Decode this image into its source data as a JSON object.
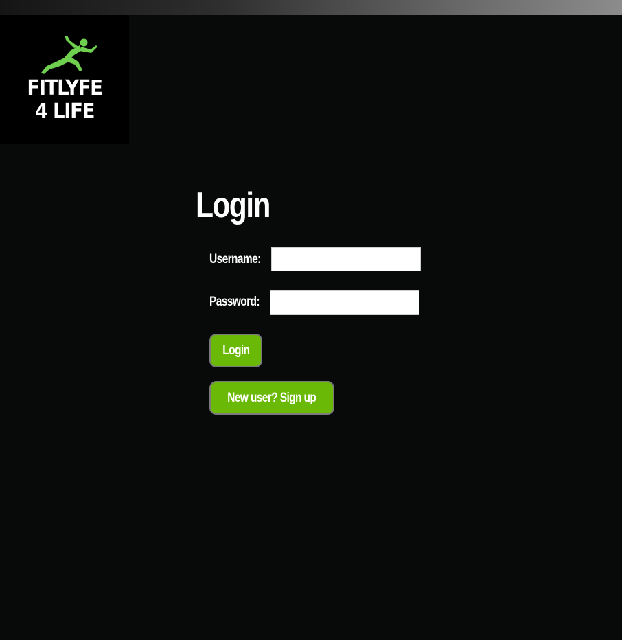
{
  "logo": {
    "line1": "FITLYFE",
    "line2": "4 LIFE",
    "accent_color": "#6fcf4f"
  },
  "login": {
    "title": "Login",
    "username_label": "Username:",
    "username_value": "",
    "password_label": "Password:",
    "password_value": "",
    "login_button": "Login",
    "signup_button": "New user? Sign up"
  },
  "colors": {
    "background": "#080a09",
    "button": "#6ab907",
    "text": "#ffffff"
  }
}
